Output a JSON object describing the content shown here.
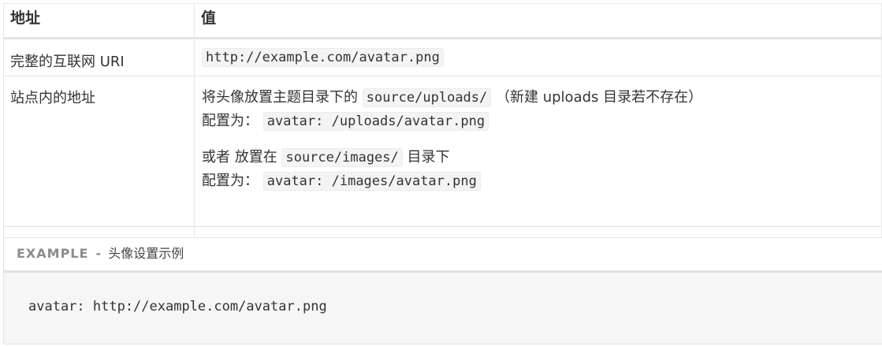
{
  "table": {
    "headers": {
      "address": "地址",
      "value": "值"
    },
    "row1": {
      "label": "完整的互联网 URI",
      "code": "http://example.com/avatar.png"
    },
    "row2": {
      "label": "站点内的地址",
      "para1": {
        "prefix": "将头像放置主题目录下的",
        "code": "source/uploads/",
        "suffix": "（新建 uploads 目录若不存在）",
        "config_label": "配置为：",
        "config_code": "avatar: /uploads/avatar.png"
      },
      "para2": {
        "prefix": "或者 放置在",
        "code": "source/images/",
        "suffix": "目录下",
        "config_label": "配置为：",
        "config_code": "avatar: /images/avatar.png"
      }
    }
  },
  "example": {
    "tag": "EXAMPLE",
    "separator": "-",
    "title": "头像设置示例",
    "code": "avatar: http://example.com/avatar.png"
  }
}
